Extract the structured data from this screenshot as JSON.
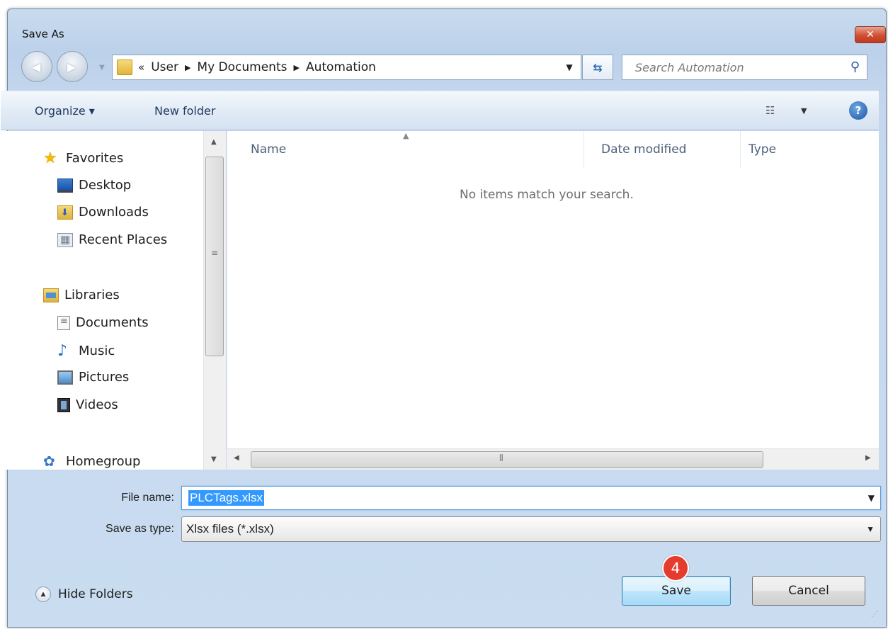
{
  "window": {
    "title": "Save As",
    "close_symbol": "✕"
  },
  "nav": {
    "back_symbol": "◀",
    "forward_symbol": "▶"
  },
  "address": {
    "overflow": "«",
    "segments": [
      "User",
      "My Documents",
      "Automation"
    ],
    "separator": "▶"
  },
  "search": {
    "placeholder": "Search Automation"
  },
  "toolbar": {
    "organize_label": "Organize ▾",
    "new_folder_label": "New folder"
  },
  "sidebar": {
    "favorites": {
      "label": "Favorites",
      "items": [
        "Desktop",
        "Downloads",
        "Recent Places"
      ]
    },
    "libraries": {
      "label": "Libraries",
      "items": [
        "Documents",
        "Music",
        "Pictures",
        "Videos"
      ]
    },
    "homegroup": {
      "label": "Homegroup"
    }
  },
  "filelist": {
    "columns": [
      "Name",
      "Date modified",
      "Type"
    ],
    "empty_message": "No items match your search."
  },
  "form": {
    "file_name_label": "File name:",
    "file_name_value": "PLCTags.xlsx",
    "save_type_label": "Save as type:",
    "save_type_value": "Xlsx files (*.xlsx)"
  },
  "buttons": {
    "hide_folders_label": "Hide Folders",
    "save_label": "Save",
    "cancel_label": "Cancel"
  },
  "annotation": {
    "step_number": "4",
    "color": "#e43b2e"
  },
  "colors": {
    "accent": "#3399ff",
    "chrome": "#c9dcf0"
  }
}
